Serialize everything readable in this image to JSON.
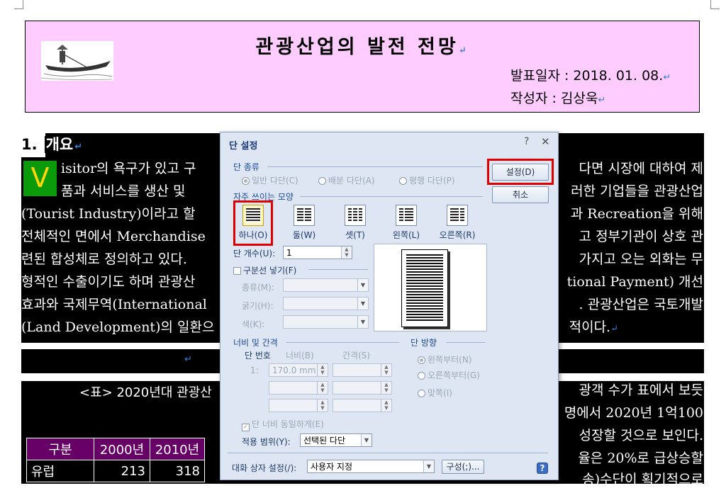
{
  "doc": {
    "title": "관광산업의 발전 전망",
    "date_line": "발표일자 : 2018. 01. 08.",
    "author_line": "작성자 : 김상욱",
    "heading_num": "1.",
    "heading_text": "개요",
    "para_lines": [
      {
        "left": "isitor의 욕구가 있고 구",
        "right": "다면 시장에 대하여 제"
      },
      {
        "left": "품과 서비스를 생산 및",
        "right": "러한 기업들을 관광산업"
      },
      {
        "left": "(Tourist Industry)이라고 할",
        "right": "과 Recreation을 위해"
      },
      {
        "left": "전체적인 면에서 Merchandise",
        "right": "고 정부기관이 상호 관"
      },
      {
        "left": "련된 합성체로 정의하고 있다.",
        "right": "가지고 오는 외화는 무"
      },
      {
        "left": "형적인 수출이기도 하며 관광산",
        "right": "tional Payment) 개선"
      },
      {
        "left": "효과와 국제무역(International",
        "right": ". 관광산업은 국토개발"
      },
      {
        "left": "(Land Development)의 일환으",
        "right": "적이다."
      }
    ],
    "vbox_letter": "V",
    "table_title": "<표> 2020년대 관광산",
    "right_lines": [
      "광객 수가 표에서 보듯",
      "명에서 2020년 1억100",
      "성장할 것으로 보인다.",
      "율은 20%로 급상승할",
      "송)수단이 획기적으로"
    ],
    "table": {
      "headers": [
        "구분",
        "2000년",
        "2010년"
      ],
      "rows": [
        [
          "유럽",
          "213",
          "318"
        ]
      ]
    }
  },
  "dialog": {
    "title": "단 설정",
    "help": "?",
    "close": "✕",
    "kind_section": "단 종류",
    "kind_options": [
      "일반 다단(C)",
      "배분 다단(A)",
      "평행 다단(P)"
    ],
    "layout_section": "자주 쓰이는 모양",
    "layouts": [
      {
        "label": "하나(O)",
        "cols": 1
      },
      {
        "label": "둘(W)",
        "cols": 2
      },
      {
        "label": "셋(T)",
        "cols": 3
      },
      {
        "label": "왼쪽(L)",
        "cols": 2
      },
      {
        "label": "오른쪽(R)",
        "cols": 2
      }
    ],
    "ok_label": "설정(D)",
    "cancel_label": "취소",
    "count_label": "단 개수(U):",
    "count_value": "1",
    "divider_label": "구분선 넣기(F)",
    "type_label": "종류(M):",
    "thickness_label": "굵기(H):",
    "color_label": "색(K):",
    "width_section": "너비 및 간격",
    "col_no_label": "단 번호",
    "width_label": "너비(B)",
    "gap_label": "간격(S)",
    "row_no": "1:",
    "width_value": "170.0 mm",
    "direction_section": "단 방향",
    "directions": [
      "왼쪽부터(N)",
      "오른쪽부터(G)",
      "맞쪽(I)"
    ],
    "equal_width_label": "단 너비 동일하게(E)",
    "scope_label": "적용 범위(Y):",
    "scope_value": "선택된 다단",
    "dlg_setting_label": "대화 상자 설정(/):",
    "dlg_setting_value": "사용자 지정",
    "compose_label": "구성(;)...",
    "help_icon_label": "?"
  },
  "colors": {
    "title_box": "#ffccff",
    "highlight": "#e00000",
    "vbox": "#0a9a0a",
    "table_header": "#660066"
  }
}
